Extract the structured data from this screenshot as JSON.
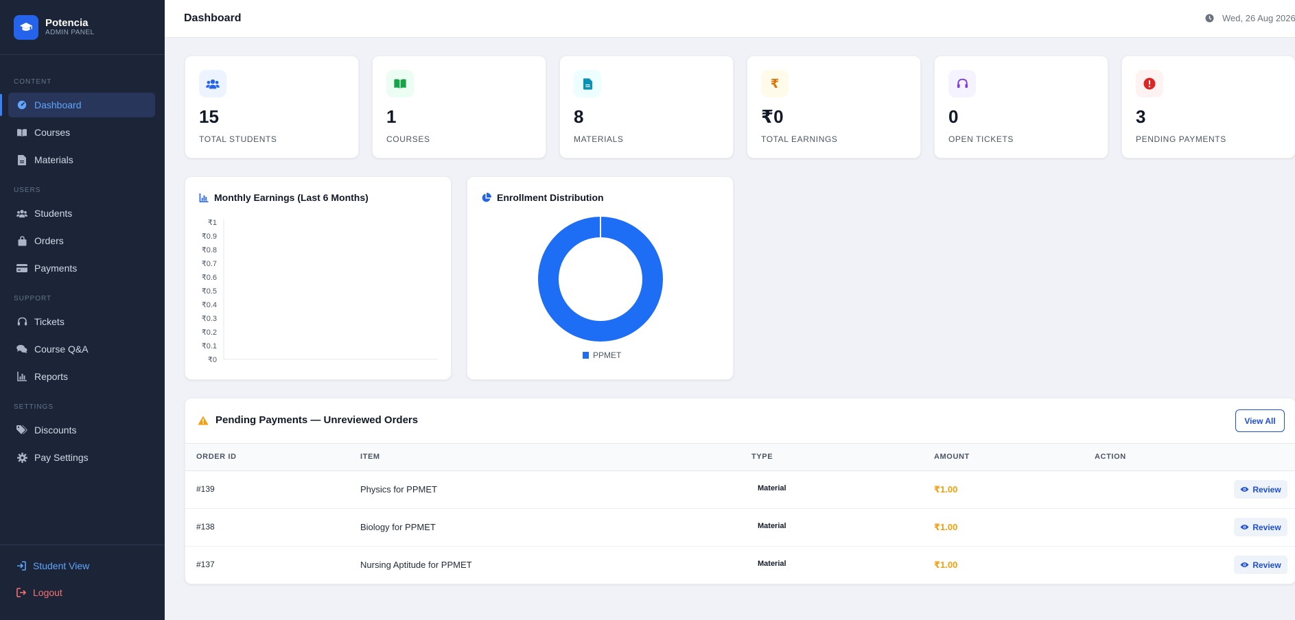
{
  "brand": {
    "name": "Potencia",
    "subtitle": "ADMIN PANEL",
    "icon": "graduation-cap-icon",
    "accent": "#2563eb"
  },
  "sidebar": {
    "sections": [
      {
        "title": "CONTENT",
        "items": [
          {
            "label": "Dashboard",
            "icon": "dashboard-gauge-icon",
            "active": true
          },
          {
            "label": "Courses",
            "icon": "book-open-icon"
          },
          {
            "label": "Materials",
            "icon": "file-icon"
          }
        ]
      },
      {
        "title": "USERS",
        "items": [
          {
            "label": "Students",
            "icon": "users-icon"
          },
          {
            "label": "Orders",
            "icon": "shopping-bag-icon"
          },
          {
            "label": "Payments",
            "icon": "credit-card-icon"
          }
        ]
      },
      {
        "title": "SUPPORT",
        "items": [
          {
            "label": "Tickets",
            "icon": "headset-icon"
          },
          {
            "label": "Course Q&A",
            "icon": "comments-icon"
          },
          {
            "label": "Reports",
            "icon": "bar-chart-icon"
          }
        ]
      },
      {
        "title": "SETTINGS",
        "items": [
          {
            "label": "Discounts",
            "icon": "tags-icon"
          },
          {
            "label": "Pay Settings",
            "icon": "gear-icon"
          }
        ]
      }
    ],
    "footer": {
      "student_view": {
        "label": "Student View",
        "icon": "sign-in-icon",
        "color": "#60a5fa"
      },
      "logout": {
        "label": "Logout",
        "icon": "sign-out-icon",
        "color": "#f87171"
      }
    }
  },
  "header": {
    "title": "Dashboard",
    "date": "Wed, 26 Aug 2026",
    "icon": "clock-icon"
  },
  "stats": [
    {
      "value": "15",
      "label": "TOTAL STUDENTS",
      "icon": "users-icon",
      "color": "#2563eb",
      "bg": "#eef4ff"
    },
    {
      "value": "1",
      "label": "COURSES",
      "icon": "book-open-icon",
      "color": "#16a34a",
      "bg": "#ecfdf3"
    },
    {
      "value": "8",
      "label": "MATERIALS",
      "icon": "file-icon",
      "color": "#0891b2",
      "bg": "#ecfeff"
    },
    {
      "value": "₹0",
      "label": "TOTAL EARNINGS",
      "icon": "rupee-icon",
      "color": "#d97706",
      "bg": "#fffbeb"
    },
    {
      "value": "0",
      "label": "OPEN TICKETS",
      "icon": "headset-icon",
      "color": "#7c3aed",
      "bg": "#f5f3ff"
    },
    {
      "value": "3",
      "label": "PENDING PAYMENTS",
      "icon": "exclamation-circle-icon",
      "color": "#dc2626",
      "bg": "#fef2f2"
    }
  ],
  "earnings_card": {
    "title": "Monthly Earnings (Last 6 Months)",
    "icon": "bar-chart-icon"
  },
  "enrollment_card": {
    "title": "Enrollment Distribution",
    "icon": "pie-chart-icon"
  },
  "chart_data": [
    {
      "type": "bar",
      "title": "Monthly Earnings (Last 6 Months)",
      "ylim": [
        0,
        1
      ],
      "y_ticks": [
        "₹1",
        "₹0.9",
        "₹0.8",
        "₹0.7",
        "₹0.6",
        "₹0.5",
        "₹0.4",
        "₹0.3",
        "₹0.2",
        "₹0.1",
        "₹0"
      ],
      "categories": [],
      "values": [],
      "grid": false
    },
    {
      "type": "pie",
      "title": "Enrollment Distribution",
      "donut": true,
      "labels": [
        "PPMET"
      ],
      "values": [
        1
      ],
      "colors": [
        "#1d6ef5"
      ],
      "legend": "bottom"
    }
  ],
  "pending": {
    "title": "Pending Payments — Unreviewed Orders",
    "icon": "warning-icon",
    "view_all": "View All",
    "columns": [
      "ORDER ID",
      "ITEM",
      "TYPE",
      "AMOUNT",
      "ACTION"
    ],
    "rows": [
      {
        "id": "#139",
        "item": "Physics for PPMET",
        "type": "Material",
        "amount": "₹1.00",
        "action": "Review"
      },
      {
        "id": "#138",
        "item": "Biology for PPMET",
        "type": "Material",
        "amount": "₹1.00",
        "action": "Review"
      },
      {
        "id": "#137",
        "item": "Nursing Aptitude for PPMET",
        "type": "Material",
        "amount": "₹1.00",
        "action": "Review"
      }
    ]
  }
}
